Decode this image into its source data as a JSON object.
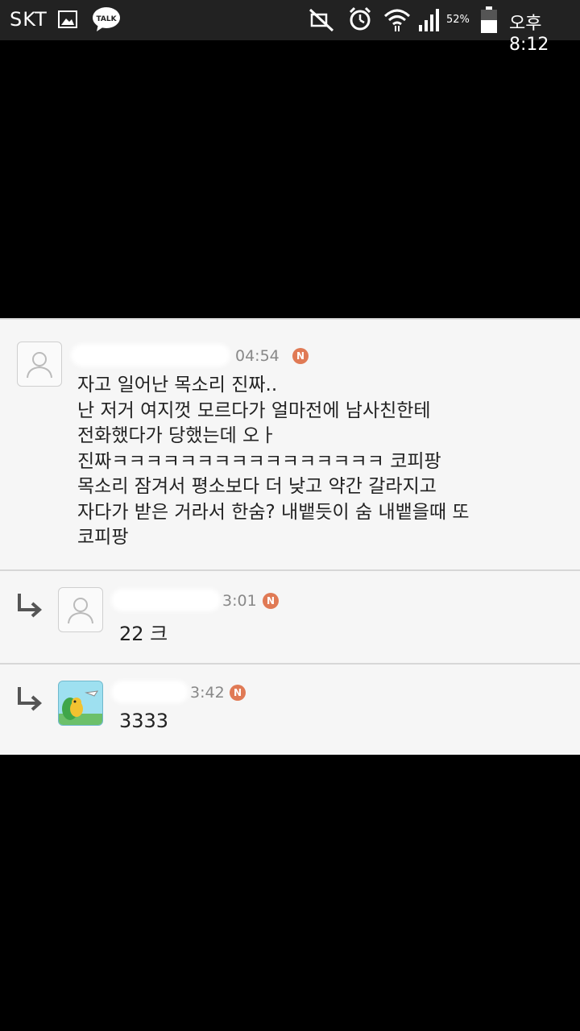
{
  "status_bar": {
    "carrier": "SKT",
    "talk_badge": "TALK",
    "battery_percent": "52%",
    "time": "오후 8:12",
    "icons": [
      "image-icon",
      "kakaotalk-icon",
      "mute-icon",
      "alarm-icon",
      "wifi-icon",
      "signal-icon",
      "battery-icon"
    ]
  },
  "comments": [
    {
      "time": "04:54",
      "badge": "N",
      "body": "자고 일어난 목소리 진짜..\n난 저거 여지껏 모르다가 얼마전에 남사친한테\n전화했다가 당했는데 오ㅏ\n진짜ㅋㅋㅋㅋㅋㅋㅋㅋㅋㅋㅋㅋㅋㅋㅋㅋ 코피팡\n목소리 잠겨서 평소보다 더 낮고 약간 갈라지고\n자다가 받은 거라서 한숨? 내뱉듯이 숨 내뱉을때 또\n코피팡"
    }
  ],
  "replies": [
    {
      "time": "3:01",
      "badge": "N",
      "text": "22 크"
    },
    {
      "time": "3:42",
      "badge": "N",
      "text": "3333"
    }
  ],
  "colors": {
    "badge": "#e07a55",
    "panel_bg": "#f6f6f6",
    "page_bg": "#000000"
  }
}
